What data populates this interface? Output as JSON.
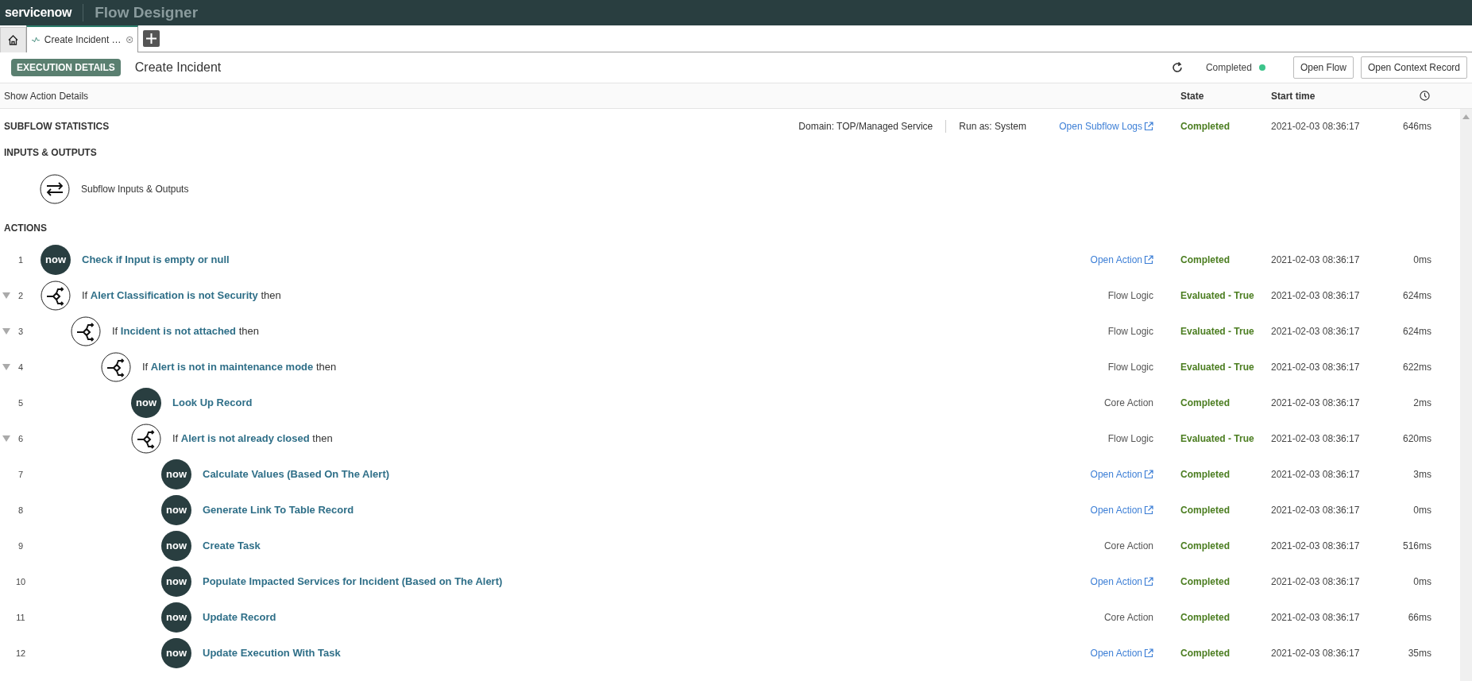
{
  "topbar": {
    "logo": "servicenow",
    "app_title": "Flow Designer"
  },
  "tabs": [
    {
      "kind": "home",
      "selected": false
    },
    {
      "kind": "flow",
      "label": "Create Incident …",
      "selected": true
    }
  ],
  "header": {
    "badge": "EXECUTION DETAILS",
    "title": "Create Incident",
    "status": "Completed",
    "buttons": [
      "Open Flow",
      "Open Context Record"
    ]
  },
  "columns": {
    "toggle": "Show Action Details",
    "state": "State",
    "start_time": "Start time"
  },
  "statistics": {
    "title": "SUBFLOW STATISTICS",
    "domain": "Domain: TOP/Managed Service",
    "run_as": "Run as: System",
    "link": "Open Subflow Logs",
    "state": "Completed",
    "start_time": "2021-02-03 08:36:17",
    "duration": "646ms"
  },
  "inputs_outputs": {
    "title": "INPUTS & OUTPUTS",
    "item": "Subflow Inputs & Outputs"
  },
  "actions_title": "ACTIONS",
  "actions": [
    {
      "number": "1",
      "kind": "action",
      "icon_text": "now",
      "name": "Check if Input is empty or null",
      "detail": {
        "kind": "link",
        "text": "Open Action"
      },
      "state": "Completed",
      "start_time": "2021-02-03 08:36:17",
      "duration": "0ms"
    },
    {
      "number": "2",
      "kind": "logic",
      "prefix": "If",
      "condition": "Alert Classification is not Security",
      "suffix": "then",
      "expanded": true,
      "detail": {
        "kind": "text",
        "text": "Flow Logic"
      },
      "state": "Evaluated - True",
      "start_time": "2021-02-03 08:36:17",
      "duration": "624ms",
      "children": [
        {
          "number": "3",
          "kind": "logic",
          "prefix": "If",
          "condition": "Incident is not attached",
          "suffix": "then",
          "expanded": true,
          "detail": {
            "kind": "text",
            "text": "Flow Logic"
          },
          "state": "Evaluated - True",
          "start_time": "2021-02-03 08:36:17",
          "duration": "624ms",
          "children": [
            {
              "number": "4",
              "kind": "logic",
              "prefix": "If",
              "condition": "Alert is not in maintenance mode",
              "suffix": "then",
              "expanded": true,
              "detail": {
                "kind": "text",
                "text": "Flow Logic"
              },
              "state": "Evaluated - True",
              "start_time": "2021-02-03 08:36:17",
              "duration": "622ms",
              "children": [
                {
                  "number": "5",
                  "kind": "action",
                  "icon_text": "now",
                  "name": "Look Up Record",
                  "detail": {
                    "kind": "text",
                    "text": "Core Action"
                  },
                  "state": "Completed",
                  "start_time": "2021-02-03 08:36:17",
                  "duration": "2ms"
                },
                {
                  "number": "6",
                  "kind": "logic",
                  "prefix": "If",
                  "condition": "Alert is not already closed",
                  "suffix": "then",
                  "expanded": true,
                  "detail": {
                    "kind": "text",
                    "text": "Flow Logic"
                  },
                  "state": "Evaluated - True",
                  "start_time": "2021-02-03 08:36:17",
                  "duration": "620ms",
                  "children": [
                    {
                      "number": "7",
                      "kind": "action",
                      "icon_text": "now",
                      "name": "Calculate Values (Based On The Alert)",
                      "detail": {
                        "kind": "link",
                        "text": "Open Action"
                      },
                      "state": "Completed",
                      "start_time": "2021-02-03 08:36:17",
                      "duration": "3ms"
                    },
                    {
                      "number": "8",
                      "kind": "action",
                      "icon_text": "now",
                      "name": "Generate Link To Table Record",
                      "detail": {
                        "kind": "link",
                        "text": "Open Action"
                      },
                      "state": "Completed",
                      "start_time": "2021-02-03 08:36:17",
                      "duration": "0ms"
                    },
                    {
                      "number": "9",
                      "kind": "action",
                      "icon_text": "now",
                      "name": "Create Task",
                      "detail": {
                        "kind": "text",
                        "text": "Core Action"
                      },
                      "state": "Completed",
                      "start_time": "2021-02-03 08:36:17",
                      "duration": "516ms"
                    },
                    {
                      "number": "10",
                      "kind": "action",
                      "icon_text": "now",
                      "name": "Populate Impacted Services for Incident (Based on The Alert)",
                      "detail": {
                        "kind": "link",
                        "text": "Open Action"
                      },
                      "state": "Completed",
                      "start_time": "2021-02-03 08:36:17",
                      "duration": "0ms"
                    },
                    {
                      "number": "11",
                      "kind": "action",
                      "icon_text": "now",
                      "name": "Update Record",
                      "detail": {
                        "kind": "text",
                        "text": "Core Action"
                      },
                      "state": "Completed",
                      "start_time": "2021-02-03 08:36:17",
                      "duration": "66ms"
                    },
                    {
                      "number": "12",
                      "kind": "action",
                      "icon_text": "now",
                      "name": "Update Execution With Task",
                      "detail": {
                        "kind": "link",
                        "text": "Open Action"
                      },
                      "state": "Completed",
                      "start_time": "2021-02-03 08:36:17",
                      "duration": "35ms"
                    }
                  ]
                }
              ]
            }
          ]
        }
      ]
    }
  ]
}
